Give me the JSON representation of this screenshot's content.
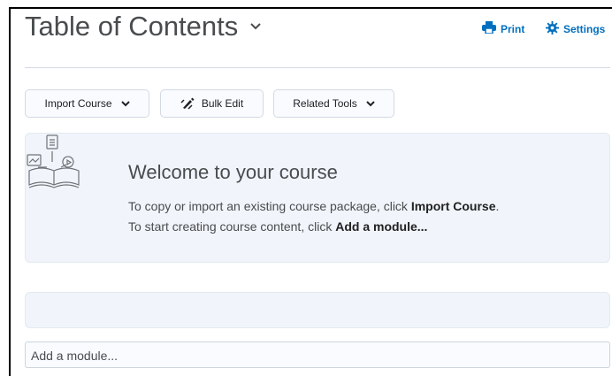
{
  "header": {
    "title": "Table of Contents",
    "print_label": "Print",
    "settings_label": "Settings"
  },
  "toolbar": {
    "import_label": "Import Course",
    "bulk_edit_label": "Bulk Edit",
    "related_tools_label": "Related Tools"
  },
  "welcome": {
    "heading": "Welcome to your course",
    "line1_prefix": "To copy or import an existing course package, click ",
    "line1_bold": "Import Course",
    "line1_suffix": ".",
    "line2_prefix": "To start creating course content, click ",
    "line2_bold": "Add a module..."
  },
  "add_module": {
    "label": "Add a module..."
  },
  "colors": {
    "accent": "#006fbf",
    "card_background": "#f1f5fb",
    "border": "#d3d9e3"
  },
  "icons": {
    "title_chevron": "chevron-down-icon",
    "print": "printer-icon",
    "settings": "gear-icon",
    "bulk_edit": "pencil-icon",
    "illustration": "book-illustration-icon"
  }
}
